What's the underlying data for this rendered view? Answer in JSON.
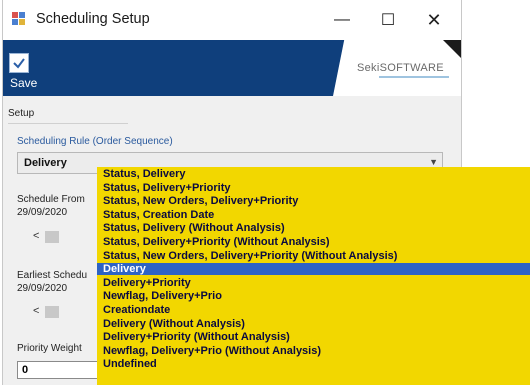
{
  "window": {
    "title": "Scheduling Setup"
  },
  "toolbar": {
    "save_label": "Save",
    "brand": "SekiSOFTWARE"
  },
  "setup": {
    "section_label": "Setup",
    "rule_label": "Scheduling Rule (Order Sequence)",
    "rule_value": "Delivery",
    "schedule_from_label": "Schedule From",
    "schedule_from_date": "29/09/2020",
    "earliest_label": "Earliest Schedu",
    "earliest_date": "29/09/2020",
    "priority_label": "Priority Weight",
    "priority_value": "0"
  },
  "dropdown": {
    "items": [
      "Status, Delivery",
      "Status, Delivery+Priority",
      "Status, New Orders, Delivery+Priority",
      "Status, Creation Date",
      "Status, Delivery (Without Analysis)",
      "Status, Delivery+Priority (Without Analysis)",
      "Status, New Orders, Delivery+Priority (Without Analysis)",
      "Delivery",
      "Delivery+Priority",
      "Newflag, Delivery+Prio",
      "Creationdate",
      "Delivery (Without Analysis)",
      "Delivery+Priority (Without Analysis)",
      "Newflag, Delivery+Prio (Without Analysis)",
      "Undefined"
    ],
    "selected_index": 7
  },
  "colors": {
    "banner": "#0f3f7c",
    "dropdown_bg": "#f2d700",
    "selected": "#2e63c4"
  }
}
